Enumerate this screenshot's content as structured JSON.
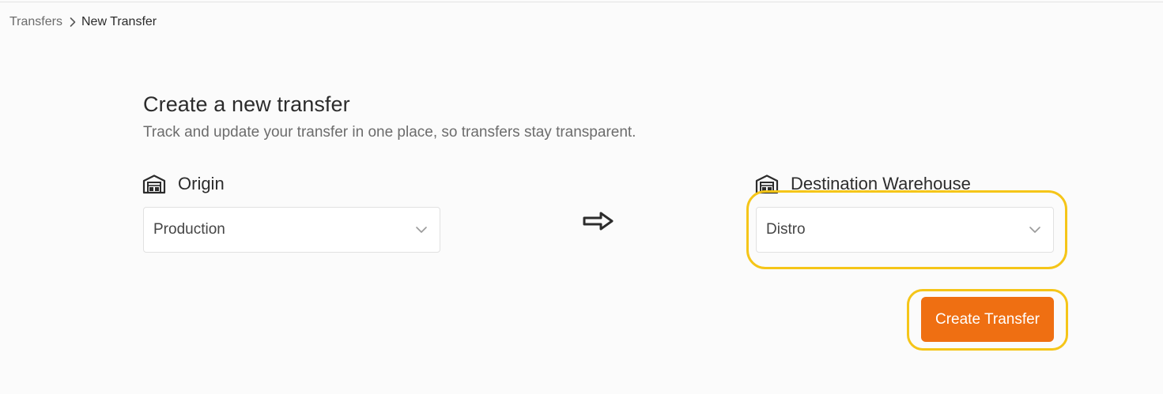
{
  "breadcrumb": {
    "parent": "Transfers",
    "current": "New Transfer",
    "separator_icon": "chevron-right-icon"
  },
  "page": {
    "title": "Create a new transfer",
    "subtitle": "Track and update your transfer in one place, so transfers stay transparent."
  },
  "origin": {
    "label": "Origin",
    "icon": "warehouse-icon",
    "selected": "Production"
  },
  "destination": {
    "label": "Destination Warehouse",
    "icon": "warehouse-icon",
    "selected": "Distro"
  },
  "arrow_icon": "right-arrow-icon",
  "actions": {
    "create_label": "Create Transfer"
  },
  "colors": {
    "accent": "#ef6f12",
    "highlight": "#f5c518",
    "background": "#fbfbfb"
  }
}
